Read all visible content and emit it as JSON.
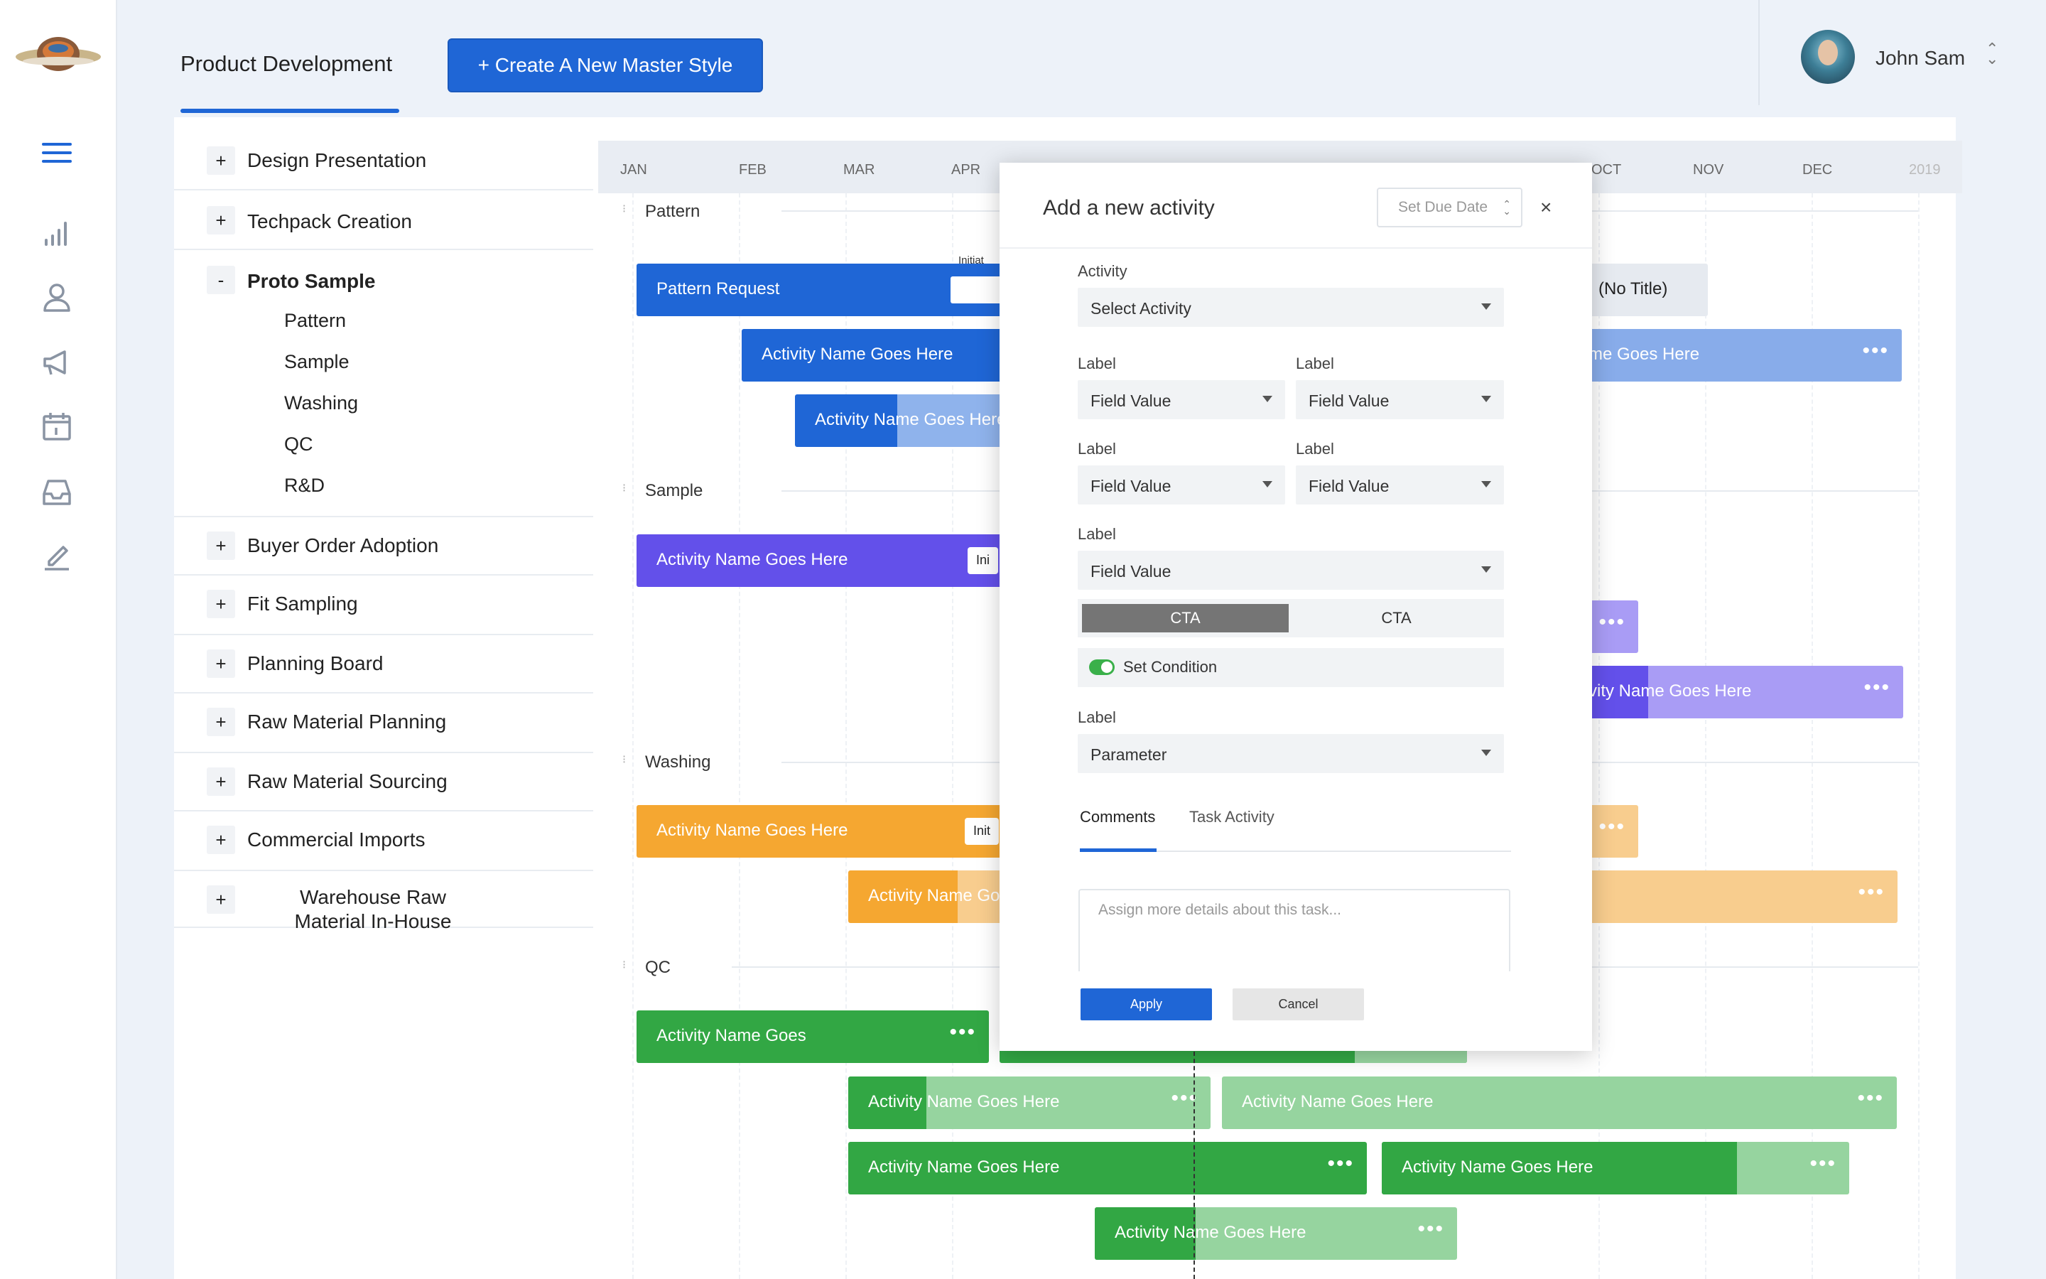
{
  "header": {
    "app_title": "Product Development",
    "create_button": "+ Create A New Master Style",
    "user_name": "John Sam",
    "user_caret": "⌃⌄"
  },
  "sidebar": {
    "icons": [
      "menu-icon",
      "chart-icon",
      "user-icon",
      "megaphone-icon",
      "calendar-icon",
      "inbox-icon",
      "edit-icon"
    ]
  },
  "tree": {
    "items": [
      {
        "toggle": "+",
        "label": "Design Presentation"
      },
      {
        "toggle": "+",
        "label": "Techpack Creation"
      },
      {
        "toggle": "-",
        "label": "Proto Sample"
      },
      {
        "toggle": "+",
        "label": "Buyer Order Adoption"
      },
      {
        "toggle": "+",
        "label": "Fit Sampling"
      },
      {
        "toggle": "+",
        "label": "Planning Board"
      },
      {
        "toggle": "+",
        "label": "Raw Material Planning"
      },
      {
        "toggle": "+",
        "label": "Raw Material Sourcing"
      },
      {
        "toggle": "+",
        "label": "Commercial Imports"
      },
      {
        "toggle": "+",
        "label": "Warehouse Raw Material In-House"
      }
    ],
    "subitems": [
      "Pattern",
      "Sample",
      "Washing",
      "QC",
      "R&D"
    ]
  },
  "timeline": {
    "months": [
      "JAN",
      "FEB",
      "MAR",
      "APR",
      "OCT",
      "NOV",
      "DEC",
      "2019"
    ],
    "sections": [
      "Pattern",
      "Sample",
      "Washing",
      "QC"
    ],
    "bar_labels": {
      "pattern_request": "Pattern Request",
      "activity": "Activity Name Goes Here",
      "activity_short": "Activity Name Goes",
      "tail_pattern": "me Goes Here",
      "tail_sample": "vity Name Goes Here",
      "no_title": "(No Title)",
      "initiate_tag": "Initiat",
      "ini_tag": "Ini",
      "init_tag": "Init",
      "washing_b": "Activity Name Go",
      "dots": "•••"
    },
    "colors": {
      "blue": "#1f66d6",
      "purple": "#6350ea",
      "orange": "#f5a731",
      "green": "#32a744"
    }
  },
  "modal": {
    "title": "Add a new activity",
    "due_date": "Set Due Date",
    "due_caret": "⌃⌄",
    "close": "×",
    "activity_label": "Activity",
    "activity_value": "Select Activity",
    "label": "Label",
    "field_value": "Field Value",
    "cta_primary": "CTA",
    "cta_secondary": "CTA",
    "set_condition": "Set Condition",
    "parameter": "Parameter",
    "tab_comments": "Comments",
    "tab_task_activity": "Task Activity",
    "comment_placeholder": "Assign more details about this task...",
    "apply": "Apply",
    "cancel": "Cancel"
  }
}
